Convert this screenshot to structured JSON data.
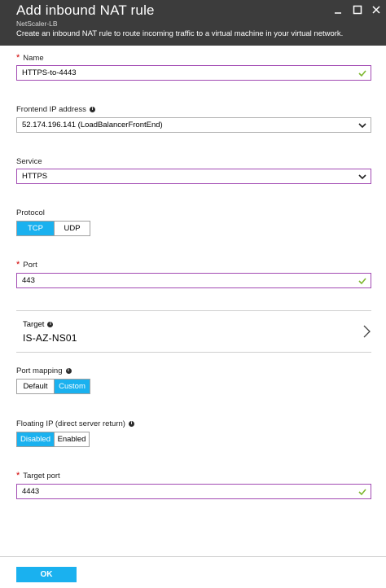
{
  "header": {
    "title": "Add inbound NAT rule",
    "subtitle": "NetScaler-LB",
    "description": "Create an inbound NAT rule to route incoming traffic to a virtual machine in your virtual network."
  },
  "form": {
    "name": {
      "label": "Name",
      "value": "HTTPS-to-4443"
    },
    "frontend_ip": {
      "label": "Frontend IP address",
      "value": "52.174.196.141 (LoadBalancerFrontEnd)"
    },
    "service": {
      "label": "Service",
      "value": "HTTPS"
    },
    "protocol": {
      "label": "Protocol",
      "options": [
        "TCP",
        "UDP"
      ],
      "selected": "TCP"
    },
    "port": {
      "label": "Port",
      "value": "443"
    },
    "target": {
      "label": "Target",
      "value": "IS-AZ-NS01"
    },
    "port_mapping": {
      "label": "Port mapping",
      "options": [
        "Default",
        "Custom"
      ],
      "selected": "Custom"
    },
    "floating_ip": {
      "label": "Floating IP (direct server return)",
      "options": [
        "Disabled",
        "Enabled"
      ],
      "selected": "Disabled"
    },
    "target_port": {
      "label": "Target port",
      "value": "4443"
    }
  },
  "footer": {
    "ok_label": "OK"
  },
  "colors": {
    "accent": "#1ab1ef",
    "header_bg": "#3c3c3c",
    "required": "#d10000",
    "valid": "#7db72f",
    "focus_border": "#a24bb3"
  },
  "icons": [
    "minimize-icon",
    "maximize-icon",
    "close-icon",
    "check-icon",
    "chevron-down-icon",
    "chevron-right-icon",
    "info-icon"
  ]
}
